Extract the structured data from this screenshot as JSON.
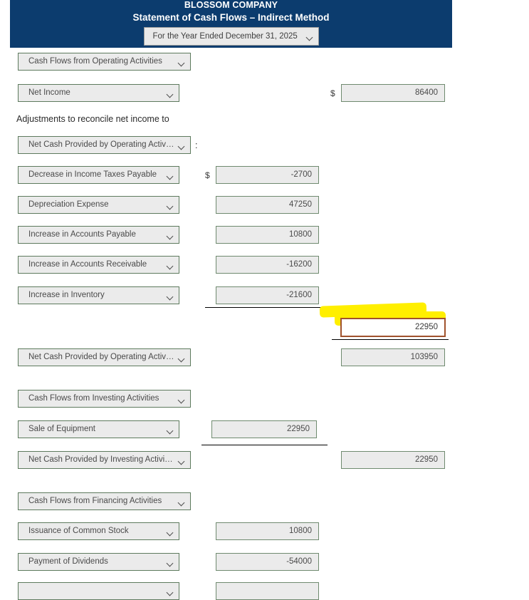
{
  "header": {
    "company": "BLOSSOM COMPANY",
    "statement_title": "Statement of Cash Flows – Indirect Method",
    "period_selected": "For the Year Ended December 31, 2025",
    "brand_color": "#0c3c6e"
  },
  "symbols": {
    "dollar": "$",
    "colon": ":"
  },
  "labels": {
    "adjustments_text": "Adjustments to reconcile net income to"
  },
  "rows": [
    {
      "id": "operating-section-header",
      "label": "Cash Flows from Operating Activities",
      "amount": "",
      "amount2": ""
    },
    {
      "id": "net-income",
      "label": "Net Income",
      "amount2": "86400"
    },
    {
      "id": "reconcile-target",
      "label": "Net Cash Provided by Operating Activities"
    },
    {
      "id": "decrease-income-taxes-payable",
      "label": "Decrease in Income Taxes Payable",
      "amount": "-2700"
    },
    {
      "id": "depreciation-expense",
      "label": "Depreciation Expense",
      "amount": "47250"
    },
    {
      "id": "increase-accounts-payable",
      "label": "Increase in Accounts Payable",
      "amount": "10800"
    },
    {
      "id": "increase-accounts-receivable",
      "label": "Increase in Accounts Receivable",
      "amount": "-16200"
    },
    {
      "id": "increase-inventory",
      "label": "Increase in Inventory",
      "amount": "-21600"
    },
    {
      "id": "adjustments-total",
      "label": "",
      "amount2": "22950",
      "highlighted": true
    },
    {
      "id": "net-cash-operating",
      "label": "Net Cash Provided by Operating Activities",
      "amount2": "103950"
    },
    {
      "id": "investing-section-header",
      "label": "Cash Flows from Investing Activities"
    },
    {
      "id": "sale-of-equipment",
      "label": "Sale of Equipment",
      "amount": "22950"
    },
    {
      "id": "net-cash-investing",
      "label": "Net Cash Provided by Investing Activities",
      "amount2": "22950"
    },
    {
      "id": "financing-section-header",
      "label": "Cash Flows from Financing Activities"
    },
    {
      "id": "issuance-common-stock",
      "label": "Issuance of Common Stock",
      "amount": "10800"
    },
    {
      "id": "payment-of-dividends",
      "label": "Payment of Dividends",
      "amount": "-54000"
    },
    {
      "id": "partial-row",
      "label": "",
      "amount": ""
    }
  ]
}
